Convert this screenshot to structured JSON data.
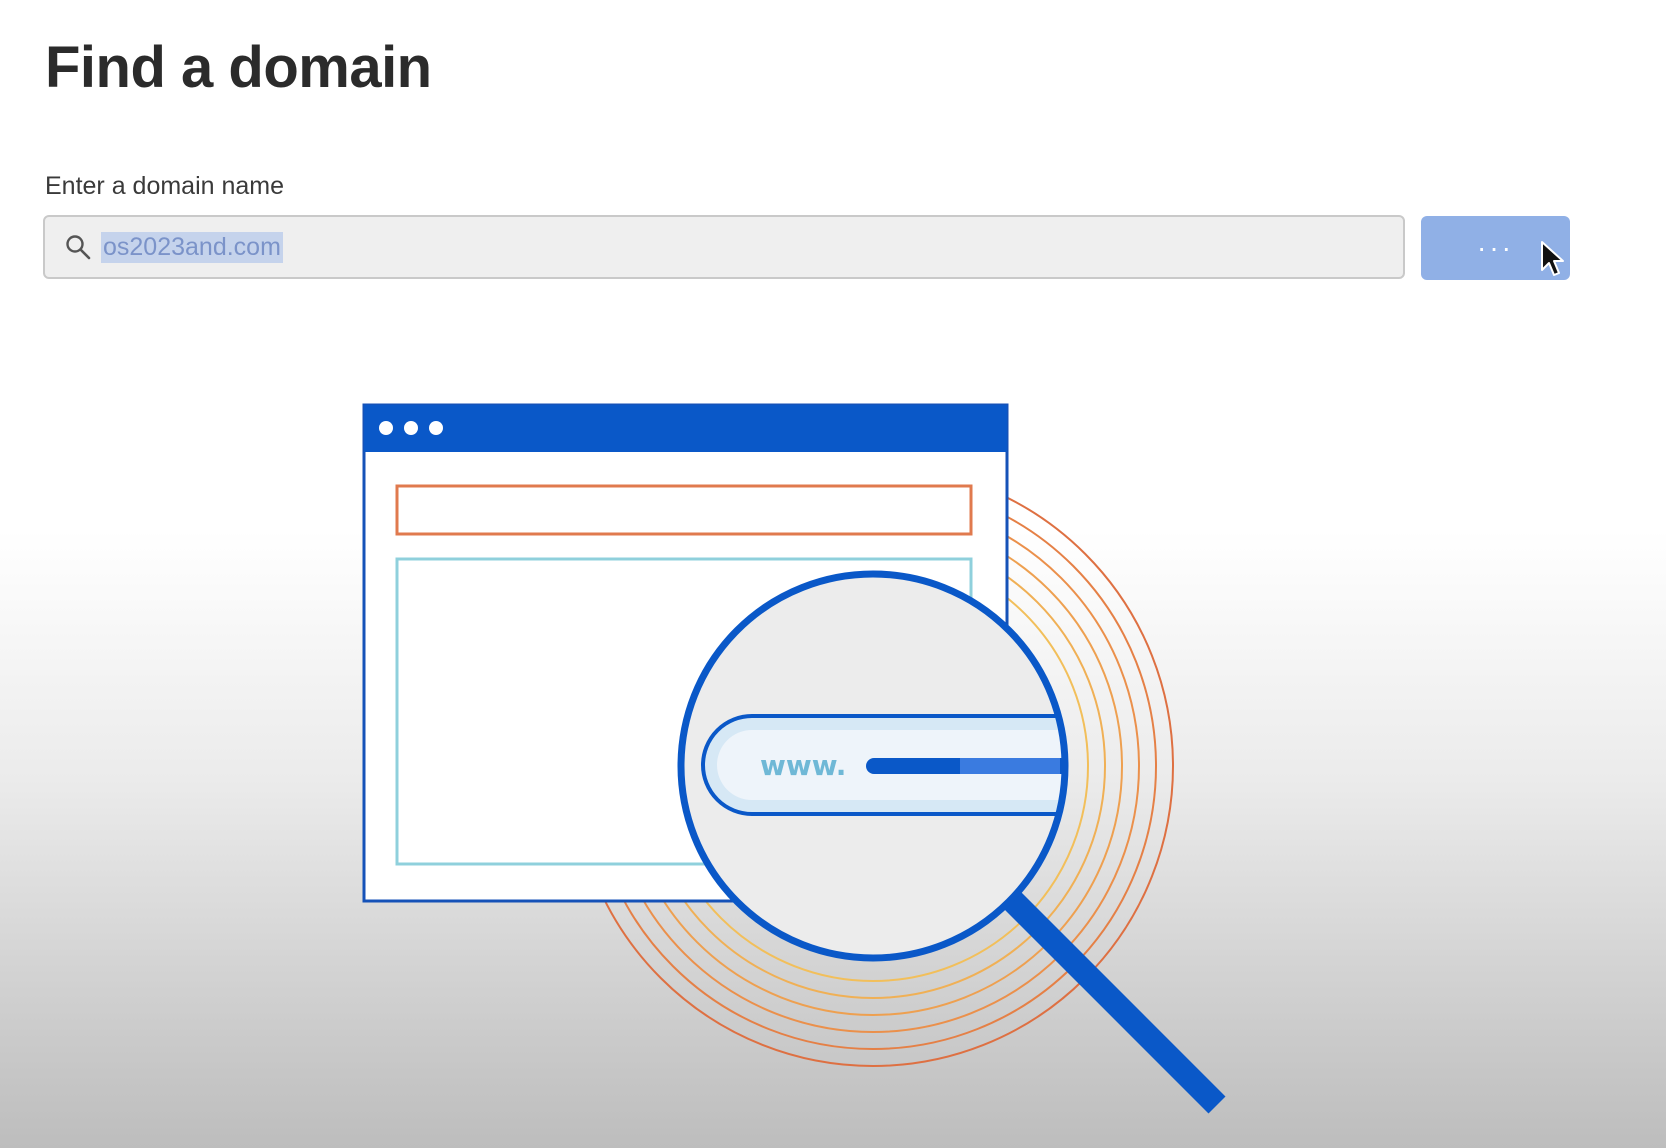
{
  "page": {
    "title": "Find a domain"
  },
  "search": {
    "label": "Enter a domain name",
    "value": "os2023and.com",
    "button_label": "···",
    "button_state": "loading"
  },
  "illustration": {
    "url_prefix": "www."
  },
  "colors": {
    "primary_blue": "#0a58c8",
    "button_disabled": "#90b0e6",
    "accent_orange": "#e07a4e",
    "accent_teal": "#8fd0dc"
  },
  "icons": {
    "search": "magnifier",
    "cursor": "arrow-pointer"
  }
}
